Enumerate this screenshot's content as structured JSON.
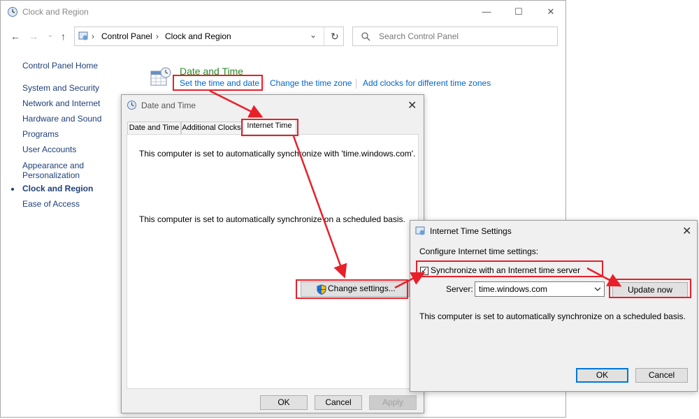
{
  "window": {
    "title": "Clock and Region",
    "minimize": "—",
    "maximize": "☐",
    "close": "✕"
  },
  "nav": {
    "back": "←",
    "forward": "→",
    "recent": "⌄",
    "up": "↑",
    "refresh": "↻",
    "dropdown": "⌄"
  },
  "breadcrumb": {
    "items": [
      "Control Panel",
      "Clock and Region"
    ],
    "separator": "›"
  },
  "search": {
    "placeholder": "Search Control Panel",
    "icon": "search-icon"
  },
  "sidebar": {
    "home": "Control Panel Home",
    "items": [
      "System and Security",
      "Network and Internet",
      "Hardware and Sound",
      "Programs",
      "User Accounts",
      "Appearance and",
      "Personalization",
      "Clock and Region",
      "Ease of Access"
    ],
    "current": "Clock and Region"
  },
  "section": {
    "title": "Date and Time",
    "links": [
      "Set the time and date",
      "Change the time zone",
      "Add clocks for different time zones"
    ],
    "icon": "calendar-clock-icon"
  },
  "date_time_dialog": {
    "title": "Date and Time",
    "close": "✕",
    "tabs": [
      "Date and Time",
      "Additional Clocks",
      "Internet Time"
    ],
    "active_tab": "Internet Time",
    "line1": "This computer is set to automatically synchronize with 'time.windows.com'.",
    "line2": "This computer is set to automatically synchronize on a scheduled basis.",
    "change_settings": "Change settings...",
    "ok": "OK",
    "cancel": "Cancel",
    "apply": "Apply"
  },
  "internet_time_dialog": {
    "title": "Internet Time Settings",
    "close": "✕",
    "heading": "Configure Internet time settings:",
    "sync_label": "Synchronize with an Internet time server",
    "sync_checked": true,
    "check_mark": "✓",
    "server_label": "Server:",
    "server_value": "time.windows.com",
    "update_now": "Update now",
    "status": "This computer is set to automatically synchronize on a scheduled basis.",
    "ok": "OK",
    "cancel": "Cancel"
  },
  "colors": {
    "highlight": "#e8202a",
    "link": "#0066cc",
    "section_title": "#2a8a2a"
  }
}
